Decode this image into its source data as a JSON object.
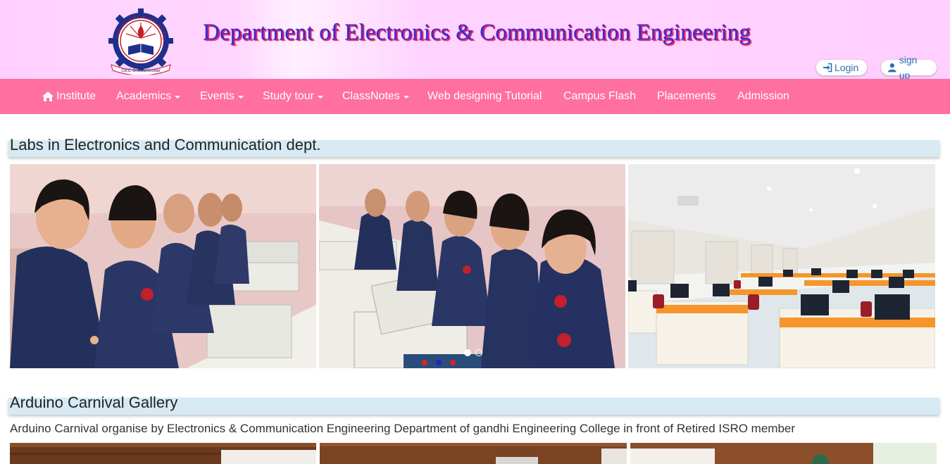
{
  "header": {
    "title": "Department of Electronics & Communication Engineering",
    "logo_text_top": "Electronics and Communication Engineering",
    "logo_text_bottom": "GEC Bhubaneswar",
    "login_label": "Login",
    "signup_label": "sign up"
  },
  "nav": {
    "items": [
      {
        "label": "Institute",
        "icon": "home-icon",
        "dropdown": false
      },
      {
        "label": "Academics",
        "dropdown": true
      },
      {
        "label": "Events",
        "dropdown": true
      },
      {
        "label": "Study tour",
        "dropdown": true
      },
      {
        "label": "ClassNotes",
        "dropdown": true
      },
      {
        "label": "Web designing Tutorial",
        "dropdown": false
      },
      {
        "label": "Campus Flash",
        "dropdown": false
      },
      {
        "label": "Placements",
        "dropdown": false
      },
      {
        "label": "Admission",
        "dropdown": false
      }
    ]
  },
  "labs": {
    "title": "Labs in Electronics and Communication dept.",
    "carousel_active_index": 0,
    "carousel_count": 2
  },
  "arduino": {
    "title": "Arduino Carnival Gallery",
    "description": "Arduino Carnival organise by Electronics & Communication Engineering Department of gandhi Engineering College in front of Retired ISRO member"
  },
  "colors": {
    "header_bg": "#ffd0ff",
    "navbar_bg": "#ff6f9f",
    "title_text": "#3a2bd1",
    "title_shadow": "#e0286a",
    "section_bar": "#d7eaf4"
  }
}
